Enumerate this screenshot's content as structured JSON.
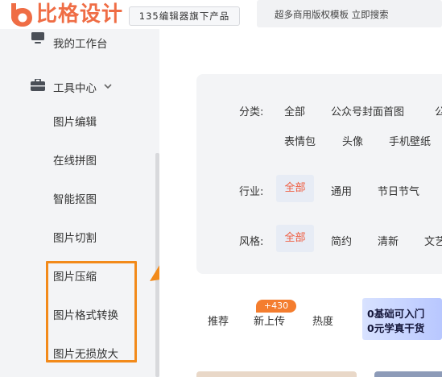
{
  "brand": {
    "name": "比格设计",
    "accent_color": "#ef6d45"
  },
  "header": {
    "tag": "135编辑器旗下产品",
    "search_placeholder": "超多商用版权模板 立即搜索"
  },
  "sidebar": {
    "items": [
      {
        "label": "我的工作台",
        "icon": "monitor-icon"
      },
      {
        "label": "工具中心",
        "icon": "toolbox-icon",
        "expanded": true
      },
      {
        "label": "图片编辑"
      },
      {
        "label": "在线拼图"
      },
      {
        "label": "智能抠图"
      },
      {
        "label": "图片切割"
      },
      {
        "label": "图片压缩"
      },
      {
        "label": "图片格式转换"
      },
      {
        "label": "图片无损放大"
      }
    ],
    "highlight_color": "#f28a1a"
  },
  "filters": {
    "category": {
      "label": "分类:",
      "options": [
        "全部",
        "公众号封面首图",
        "公",
        "表情包",
        "头像",
        "手机壁纸"
      ]
    },
    "industry": {
      "label": "行业:",
      "options": [
        "全部",
        "通用",
        "节日节气"
      ],
      "selected": "全部"
    },
    "style": {
      "label": "风格:",
      "options": [
        "全部",
        "简约",
        "清新",
        "文艺"
      ],
      "selected": "全部"
    }
  },
  "tabs": {
    "items": [
      "推荐",
      "新上传",
      "热度"
    ],
    "new_badge": "+430"
  },
  "promo": {
    "line1": "0基础可入门",
    "line2": "0元学真干货"
  }
}
